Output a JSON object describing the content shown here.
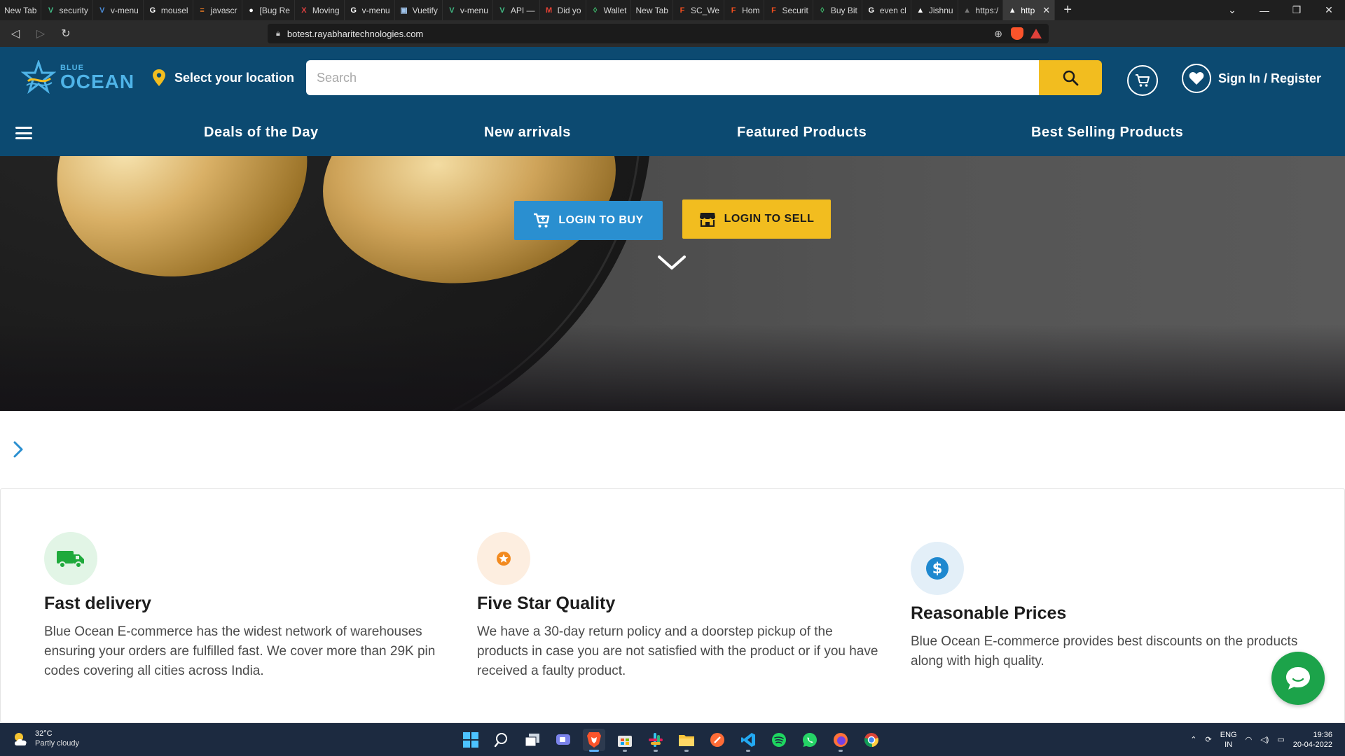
{
  "browser": {
    "tabs": [
      {
        "label": "New Tab",
        "icon": "none"
      },
      {
        "label": "security",
        "icon": "vue-icon"
      },
      {
        "label": "v-menu",
        "icon": "vue-icon"
      },
      {
        "label": "mousel",
        "icon": "google-icon"
      },
      {
        "label": "javascr",
        "icon": "stackoverflow-icon"
      },
      {
        "label": "[Bug Re",
        "icon": "github-icon"
      },
      {
        "label": "Moving",
        "icon": "x-icon"
      },
      {
        "label": "v-menu",
        "icon": "google-icon"
      },
      {
        "label": "Vuetify",
        "icon": "page-icon"
      },
      {
        "label": "v-menu",
        "icon": "vue-icon"
      },
      {
        "label": "API —",
        "icon": "vue-icon"
      },
      {
        "label": "Did yo",
        "icon": "gmail-icon"
      },
      {
        "label": "Wallet",
        "icon": "pin-icon"
      },
      {
        "label": "New Tab",
        "icon": "none"
      },
      {
        "label": "SC_We",
        "icon": "figma-icon"
      },
      {
        "label": "Hom",
        "icon": "figma-icon"
      },
      {
        "label": "Securit",
        "icon": "figma-icon"
      },
      {
        "label": "Buy Bit",
        "icon": "pin-icon"
      },
      {
        "label": "even cl",
        "icon": "google-icon"
      },
      {
        "label": "Jishnu",
        "icon": "triangle-icon"
      },
      {
        "label": "https:/",
        "icon": "triangle-icon"
      },
      {
        "label": "http",
        "icon": "triangle-icon"
      }
    ],
    "url": "botest.rayabharitechnologies.com"
  },
  "header": {
    "logo_small": "BLUE",
    "logo_big": "OCEAN",
    "location_label": "Select your location",
    "search_placeholder": "Search",
    "signin_label": "Sign In / Register"
  },
  "nav": {
    "items": [
      "Deals of the Day",
      "New arrivals",
      "Featured Products",
      "Best Selling Products"
    ]
  },
  "hero": {
    "buy_label": "LOGIN TO BUY",
    "sell_label": "LOGIN TO SELL"
  },
  "features": [
    {
      "title": "Fast delivery",
      "text": "Blue Ocean E-commerce has the widest network of warehouses ensuring your orders are fulfilled fast. We cover more than 29K pin codes covering all cities across India.",
      "icon": "truck-icon",
      "color": "#1faa3c"
    },
    {
      "title": "Five Star Quality",
      "text": "We have a 30-day return policy and a doorstep pickup of the products in case you are not satisfied with the product or if you have received a faulty product.",
      "icon": "star-icon",
      "color": "#f28a1f"
    },
    {
      "title": "Reasonable Prices",
      "text": "Blue Ocean E-commerce provides best discounts on the products along with high quality.",
      "icon": "dollar-icon",
      "color": "#1e88cf"
    }
  ],
  "taskbar": {
    "weather_temp": "32°C",
    "weather_desc": "Partly cloudy",
    "lang_top": "ENG",
    "lang_bottom": "IN",
    "time": "19:36",
    "date": "20-04-2022"
  },
  "colors": {
    "header_bg": "#0c4a71",
    "accent_yellow": "#f2bd1f",
    "buy_blue": "#2a8fd0",
    "chat_green": "#1ca34a"
  }
}
